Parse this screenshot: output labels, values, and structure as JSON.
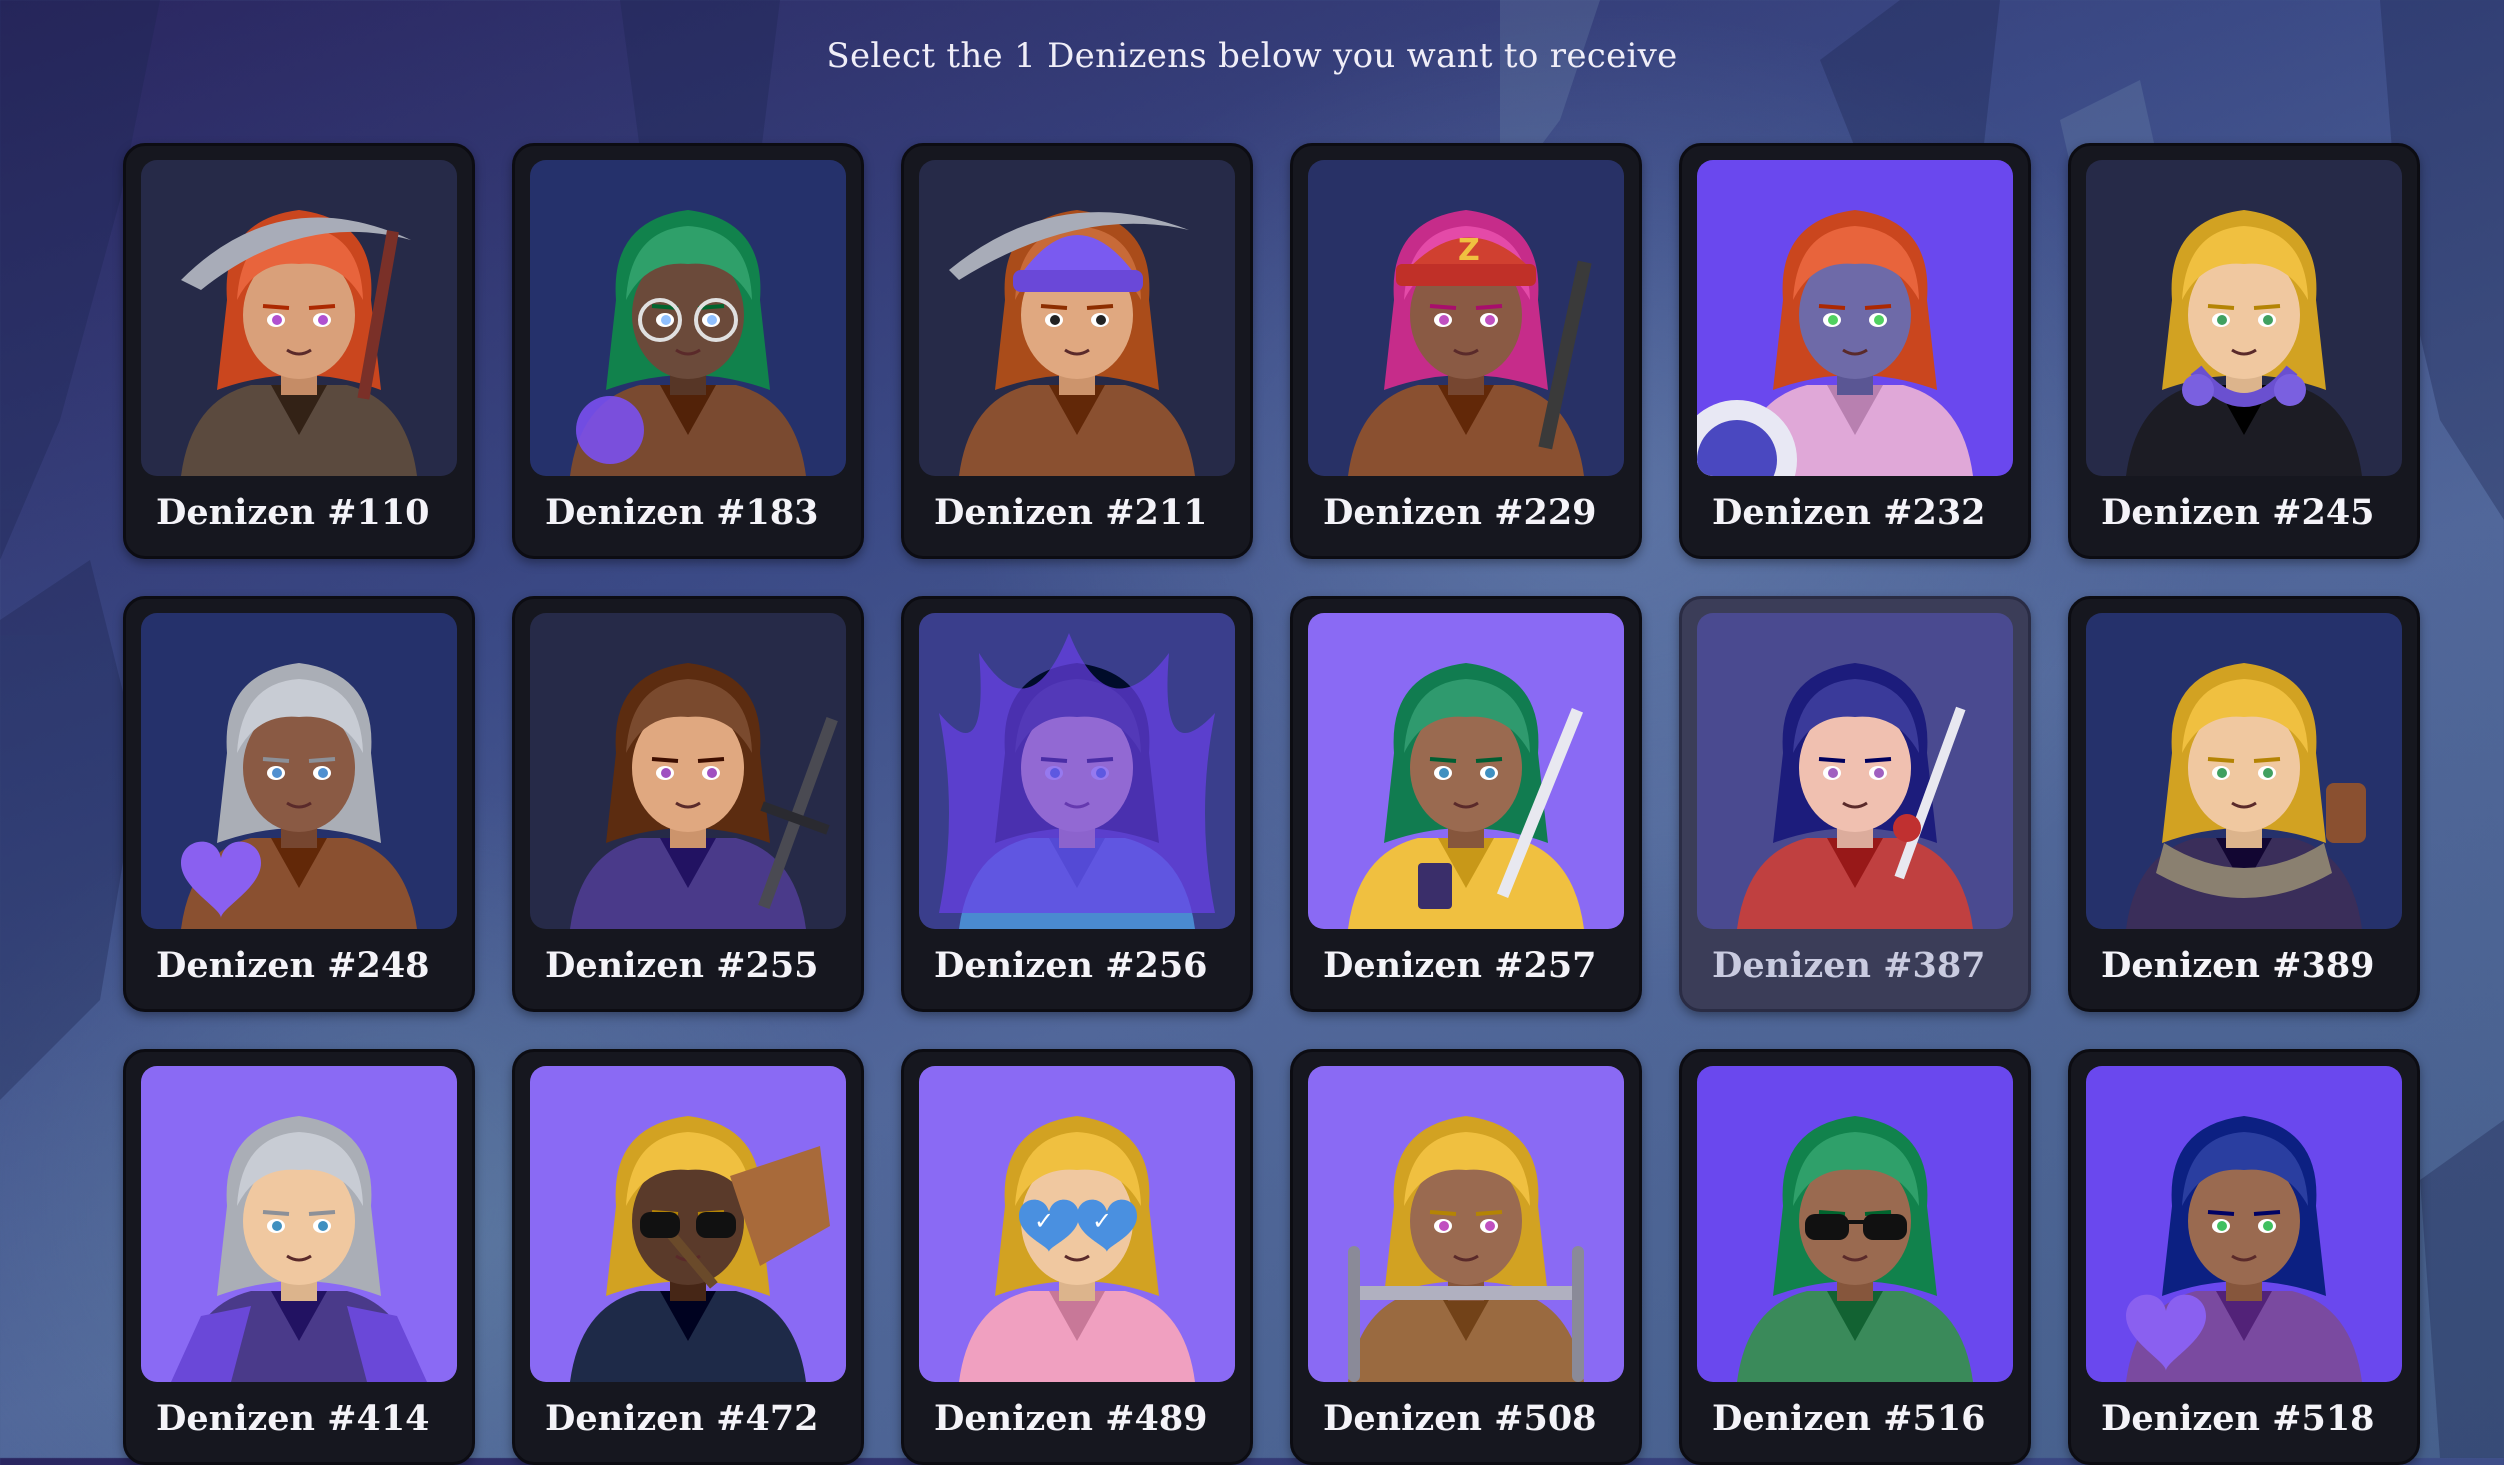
{
  "prompt": "Select the 1 Denizens below you want to receive",
  "denizens": [
    {
      "name": "Denizen #110",
      "bg": "#262a48",
      "hair": "#e8643c",
      "skin": "#d9a07a",
      "outfit": "#5b4a3e",
      "eyes": "#b050d0",
      "accessory": "pickaxe-icon"
    },
    {
      "name": "Denizen #183",
      "bg": "#25316b",
      "hair": "#2fa06a",
      "skin": "#6b4a3a",
      "outfit": "#7a4a30",
      "eyes": "#90c0ff",
      "accessory": "glasses-icon"
    },
    {
      "name": "Denizen #211",
      "bg": "#262a48",
      "hair": "#c86a38",
      "skin": "#e0a880",
      "outfit": "#8a5030",
      "eyes": "#222222",
      "accessory": "beanie-icon"
    },
    {
      "name": "Denizen #229",
      "bg": "#283166",
      "hair": "#e44aa8",
      "skin": "#8a5a44",
      "outfit": "#8a5030",
      "eyes": "#c050c0",
      "accessory": "cap-icon"
    },
    {
      "name": "Denizen #232",
      "bg": "#6a48ee",
      "hair": "#e8643c",
      "skin": "#6e6aa8",
      "outfit": "#e0a8d8",
      "eyes": "#50d060",
      "accessory": "shield-icon"
    },
    {
      "name": "Denizen #245",
      "bg": "#262a48",
      "hair": "#f0c040",
      "skin": "#f0c8a0",
      "outfit": "#1c1c24",
      "eyes": "#40a060",
      "accessory": "headphones-icon"
    },
    {
      "name": "Denizen #248",
      "bg": "#25316b",
      "hair": "#c8ccd4",
      "skin": "#8a5a44",
      "outfit": "#8a5030",
      "eyes": "#5090d0",
      "accessory": "heart-icon"
    },
    {
      "name": "Denizen #255",
      "bg": "#262a48",
      "hair": "#7a4a2e",
      "skin": "#e0a880",
      "outfit": "#4a3a8a",
      "eyes": "#a050c0",
      "accessory": "sword-icon"
    },
    {
      "name": "Denizen #256",
      "bg": "#3a3e8c",
      "hair": "#1e2a48",
      "skin": "#f0c8a0",
      "outfit": "#4a8ad0",
      "eyes": "#4090d0",
      "accessory": "flames-icon"
    },
    {
      "name": "Denizen #257",
      "bg": "#8a6af4",
      "hair": "#2f9a6e",
      "skin": "#9a6a50",
      "outfit": "#f0c040",
      "eyes": "#4090c0",
      "accessory": "katana-icon"
    },
    {
      "name": "Denizen #387",
      "bg": "#4a4a90",
      "hair": "#3a3a9a",
      "skin": "#f0c0b0",
      "outfit": "#c04040",
      "eyes": "#a060c0",
      "accessory": "rose-icon",
      "dim": true
    },
    {
      "name": "Denizen #389",
      "bg": "#25316b",
      "hair": "#f0c040",
      "skin": "#f0c8a0",
      "outfit": "#3a2e5a",
      "eyes": "#40a060",
      "accessory": "scarf-icon"
    },
    {
      "name": "Denizen #414",
      "bg": "#8a6af4",
      "hair": "#c8ccd4",
      "skin": "#f0c8a0",
      "outfit": "#4a3a8a",
      "eyes": "#4090c0",
      "accessory": "jacket-icon"
    },
    {
      "name": "Denizen #472",
      "bg": "#8a6af4",
      "hair": "#f0c040",
      "skin": "#5a3a2a",
      "outfit": "#1e2a48",
      "eyes": "#222222",
      "accessory": "broom-icon"
    },
    {
      "name": "Denizen #489",
      "bg": "#8a6af4",
      "hair": "#f0c040",
      "skin": "#f0c8a0",
      "outfit": "#f0a0c0",
      "eyes": "#4a90e0",
      "accessory": "heart-glasses-icon"
    },
    {
      "name": "Denizen #508",
      "bg": "#8a6af4",
      "hair": "#f0c040",
      "skin": "#9a6a50",
      "outfit": "#9a6a40",
      "eyes": "#c050c0",
      "accessory": "wheelchair-icon"
    },
    {
      "name": "Denizen #516",
      "bg": "#6a48ee",
      "hair": "#2fa06a",
      "skin": "#9a6a50",
      "outfit": "#3a8a5a",
      "eyes": "#222222",
      "accessory": "sunglasses-icon"
    },
    {
      "name": "Denizen #518",
      "bg": "#6a48ee",
      "hair": "#2a3ea0",
      "skin": "#9a6a50",
      "outfit": "#7a4aa0",
      "eyes": "#40c060",
      "accessory": "heart-icon"
    }
  ]
}
